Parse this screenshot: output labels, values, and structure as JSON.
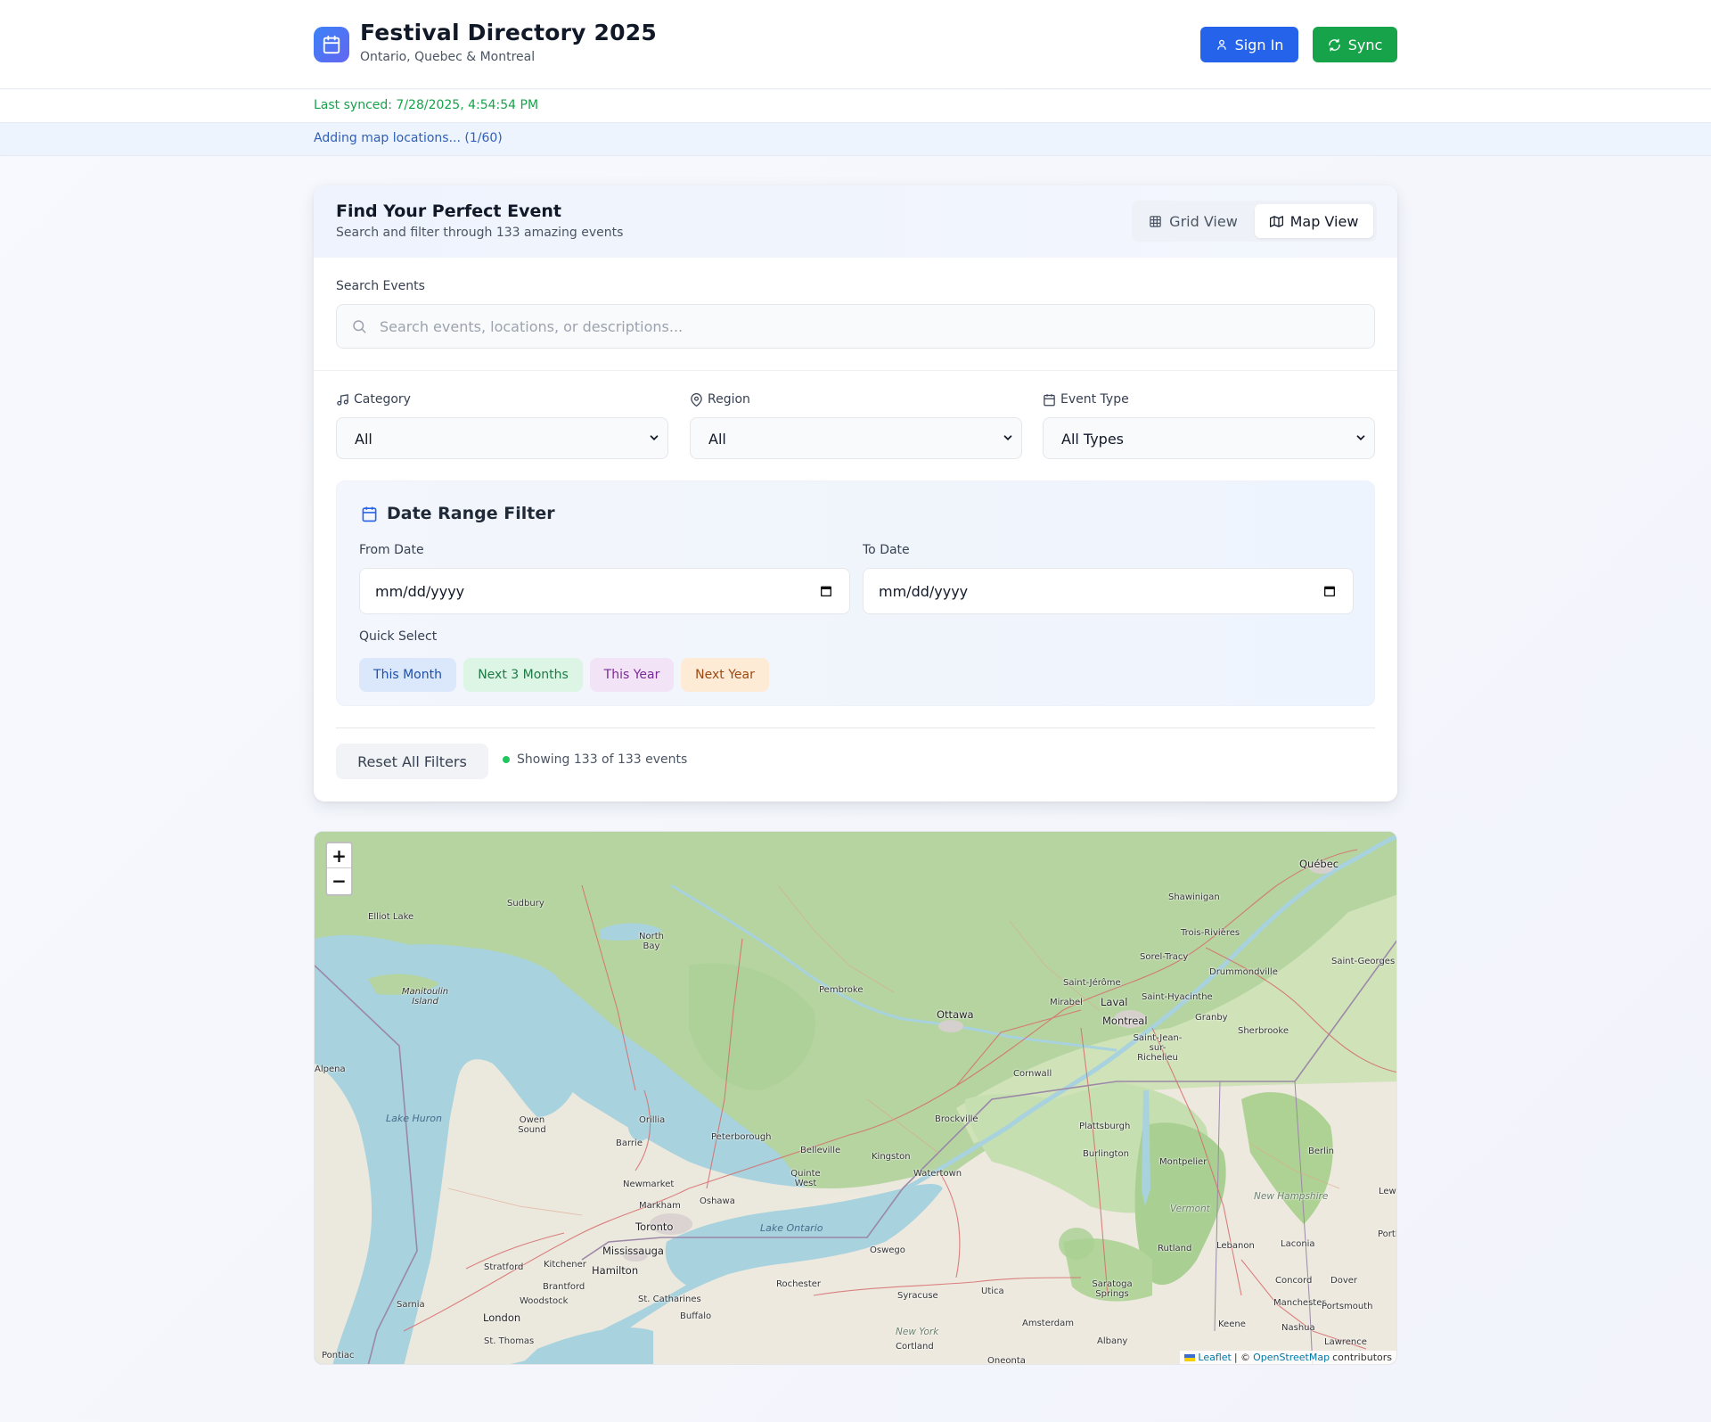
{
  "header": {
    "title": "Festival Directory 2025",
    "subtitle": "Ontario, Quebec & Montreal",
    "signin_label": "Sign In",
    "sync_label": "Sync"
  },
  "status": {
    "last_synced": "Last synced: 7/28/2025, 4:54:54 PM",
    "progress": "Adding map locations... (1/60)"
  },
  "filters": {
    "title": "Find Your Perfect Event",
    "subtitle": "Search and filter through 133 amazing events",
    "view_toggle": {
      "grid_label": "Grid View",
      "map_label": "Map View",
      "active": "Map View"
    },
    "search": {
      "label": "Search Events",
      "placeholder": "Search events, locations, or descriptions...",
      "value": ""
    },
    "category": {
      "label": "Category",
      "value": "All"
    },
    "region": {
      "label": "Region",
      "value": "All"
    },
    "event_type": {
      "label": "Event Type",
      "value": "All Types"
    },
    "date_range": {
      "title": "Date Range Filter",
      "from_label": "From Date",
      "from_value": "mm/dd/yyyy",
      "to_label": "To Date",
      "to_value": "mm/dd/yyyy",
      "quick_select_label": "Quick Select",
      "quick_select": [
        "This Month",
        "Next 3 Months",
        "This Year",
        "Next Year"
      ]
    },
    "reset_label": "Reset All Filters",
    "result_count": "Showing 133 of 133 events"
  },
  "map": {
    "zoom_in": "+",
    "zoom_out": "−",
    "attribution": {
      "leaflet": "Leaflet",
      "separator": "| ©",
      "osm": "OpenStreetMap",
      "suffix": "contributors"
    },
    "places": [
      "Québec",
      "Shawinigan",
      "Trois-Rivières",
      "Sorel-Tracy",
      "Drummondville",
      "Saint-Georges",
      "Saint-Jérôme",
      "Saint-Hyacinthe",
      "Mirabel",
      "Laval",
      "Montreal",
      "Granby",
      "Sherbrooke",
      "Saint-Jean-sur-Richelieu",
      "Ottawa",
      "Pembroke",
      "Cornwall",
      "Brockville",
      "Kingston",
      "Watertown",
      "Belleville",
      "Quinte West",
      "Peterborough",
      "Oshawa",
      "Markham",
      "Newmarket",
      "Toronto",
      "Mississauga",
      "Hamilton",
      "Kitchener",
      "Stratford",
      "Brantford",
      "Woodstock",
      "London",
      "St. Thomas",
      "Sarnia",
      "Pontiac",
      "Alpena",
      "Owen Sound",
      "Barrie",
      "Orillia",
      "Sudbury",
      "Elliot Lake",
      "North Bay",
      "Manitoulin Island",
      "St. Catharines",
      "Buffalo",
      "Rochester",
      "Syracuse",
      "Utica",
      "Oswego",
      "Cortland",
      "Oneonta",
      "Albany",
      "Amsterdam",
      "Saratoga Springs",
      "Plattsburgh",
      "Burlington",
      "Montpelier",
      "Rutland",
      "Lebanon",
      "Laconia",
      "Concord",
      "Dover",
      "Manchester",
      "Portsmouth",
      "Nashua",
      "Keene",
      "Lawrence",
      "Berlin",
      "Lew",
      "Portl"
    ],
    "water_labels": [
      "Lake Huron",
      "Lake Ontario"
    ],
    "region_labels": [
      "Vermont",
      "New Hampshire",
      "New York"
    ]
  }
}
